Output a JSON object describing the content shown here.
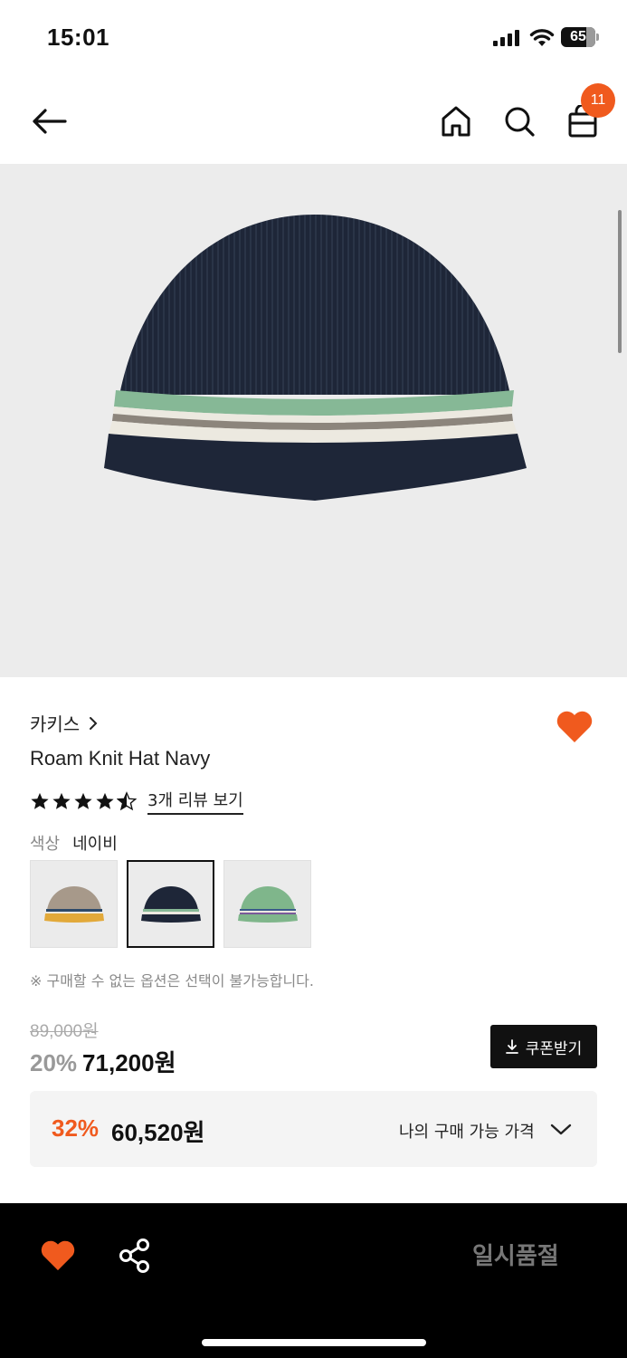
{
  "status_bar": {
    "time": "15:01",
    "battery": "65"
  },
  "nav": {
    "cart_count": "11"
  },
  "product": {
    "brand": "카키스",
    "name": "Roam Knit Hat Navy",
    "rating": 4.5,
    "review_link": "3개 리뷰 보기",
    "color_label": "색상",
    "color_value": "네이비",
    "swatches": [
      {
        "name": "beige",
        "color": "#a7998a"
      },
      {
        "name": "navy",
        "color": "#1e2638"
      },
      {
        "name": "green",
        "color": "#7fb68b"
      }
    ],
    "selected_swatch": 1,
    "notice": "※ 구매할 수 없는 옵션은 선택이 불가능합니다."
  },
  "price": {
    "original": "89,000원",
    "discount_rate": "20%",
    "sale": "71,200원",
    "coupon_label": "쿠폰받기",
    "my_rate": "32%",
    "my_price": "60,520원",
    "my_price_label": "나의 구매 가능 가격"
  },
  "bottom_bar": {
    "soldout_label": "일시품절"
  },
  "colors": {
    "accent": "#f05a1e",
    "navy": "#1e2638",
    "background": "#ececec"
  },
  "icons": [
    "back-arrow-icon",
    "home-icon",
    "search-icon",
    "shopping-bag-icon",
    "heart-icon",
    "share-icon",
    "download-icon",
    "chevron-down-icon",
    "star-icon"
  ]
}
